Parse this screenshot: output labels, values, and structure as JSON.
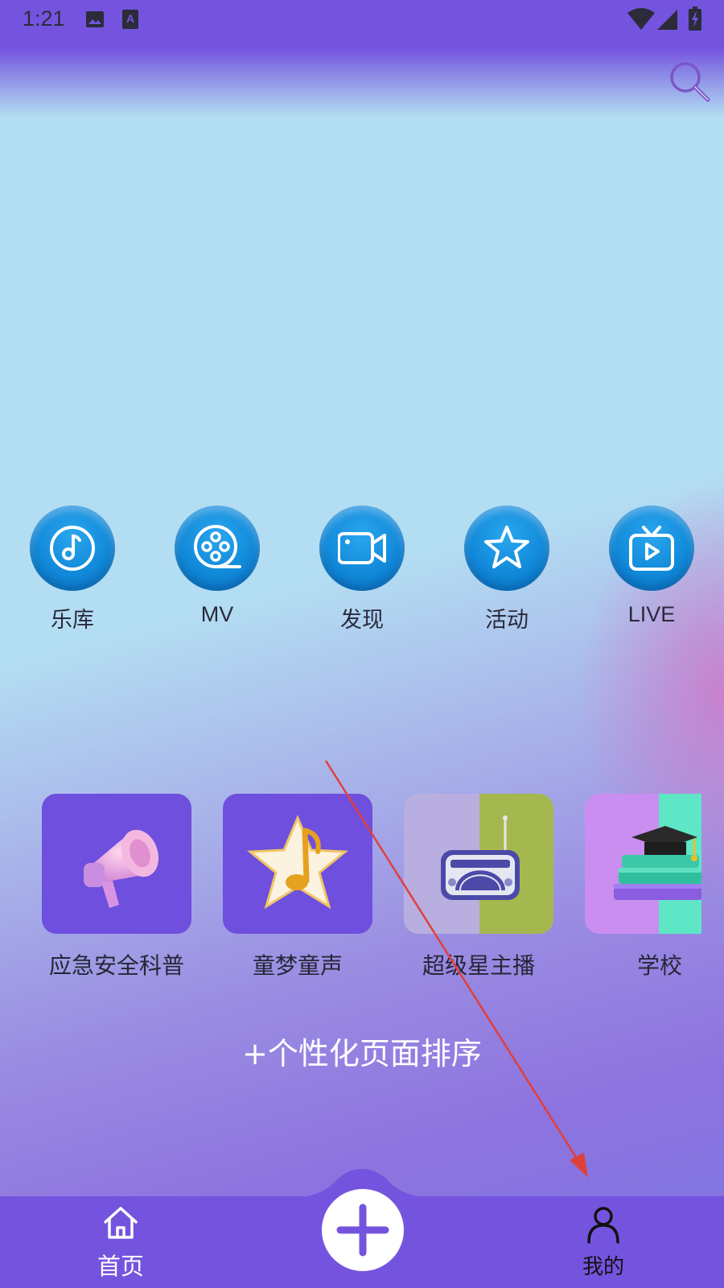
{
  "status_bar": {
    "time": "1:21",
    "icons": [
      "image-icon",
      "text-a-icon",
      "wifi-icon",
      "signal-icon",
      "battery-icon"
    ]
  },
  "header": {
    "search_icon": "search-icon"
  },
  "quick_nav": [
    {
      "label": "乐库",
      "icon": "music-note-icon"
    },
    {
      "label": "MV",
      "icon": "film-reel-icon"
    },
    {
      "label": "发现",
      "icon": "video-camera-icon"
    },
    {
      "label": "活动",
      "icon": "star-icon"
    },
    {
      "label": "LIVE",
      "icon": "tv-play-icon"
    }
  ],
  "cards": [
    {
      "label": "应急安全科普",
      "icon": "megaphone-icon"
    },
    {
      "label": "童梦童声",
      "icon": "star-music-icon"
    },
    {
      "label": "超级星主播",
      "icon": "radio-icon"
    },
    {
      "label": "学校",
      "icon": "graduation-cap-icon"
    }
  ],
  "sort_link": "+个性化页面排序",
  "bottom_nav": {
    "home_label": "首页",
    "mine_label": "我的",
    "add_icon": "plus-icon"
  },
  "colors": {
    "brand_purple": "#7454de",
    "sky_blue": "#b3ddf2",
    "icon_blue": "#1189d9",
    "annotation_red": "#e0403a"
  }
}
